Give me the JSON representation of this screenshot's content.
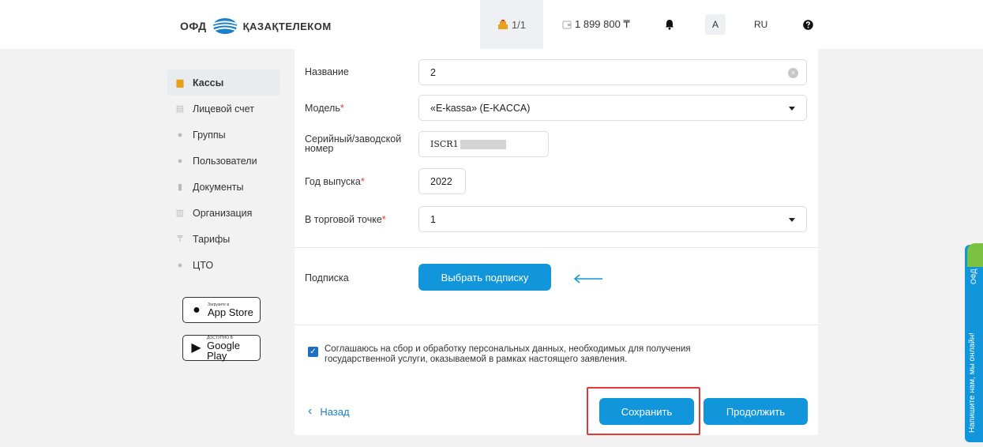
{
  "header": {
    "logo_prefix": "ОФД",
    "logo_name": "ҚАЗАҚТЕЛЕКОМ",
    "cash_counter": "1/1",
    "balance": "1 899 800 ₸",
    "avatar_letter": "A",
    "language": "RU"
  },
  "sidebar": {
    "items": [
      {
        "label": "Кассы",
        "icon": "register-icon"
      },
      {
        "label": "Лицевой счет",
        "icon": "account-icon"
      },
      {
        "label": "Группы",
        "icon": "groups-icon"
      },
      {
        "label": "Пользователи",
        "icon": "users-icon"
      },
      {
        "label": "Документы",
        "icon": "documents-icon"
      },
      {
        "label": "Организация",
        "icon": "organization-icon"
      },
      {
        "label": "Тарифы",
        "icon": "tariff-icon"
      },
      {
        "label": "ЦТО",
        "icon": "service-icon"
      }
    ],
    "app_store": {
      "small": "Загрузите в",
      "big": "App Store"
    },
    "google_play": {
      "small": "ДОСТУПНО В",
      "big": "Google Play"
    }
  },
  "form": {
    "name": {
      "label": "Название",
      "value": "2"
    },
    "model": {
      "label": "Модель",
      "required_mark": "*",
      "value": "«E-kassa» (E-KACCA)"
    },
    "serial": {
      "label": "Серийный/заводской номер",
      "value": "ISCR1"
    },
    "year": {
      "label": "Год выпуска",
      "required_mark": "*",
      "value": "2022"
    },
    "point": {
      "label": "В торговой точке",
      "required_mark": "*",
      "value": "1"
    },
    "subscription": {
      "label": "Подписка",
      "button": "Выбрать подписку"
    },
    "consent": "Соглашаюсь на сбор и обработку персональных данных, необходимых для получения государственной услуги, оказываемой в рамках настоящего заявления.",
    "back": "Назад",
    "save": "Сохранить",
    "continue": "Продолжить"
  },
  "chat": {
    "text": "Напишите нам, мы онлайн!",
    "brand": "ОФД"
  },
  "colors": {
    "accent": "#1296db",
    "highlight": "#e53935",
    "active_icon": "#e8a21a"
  }
}
